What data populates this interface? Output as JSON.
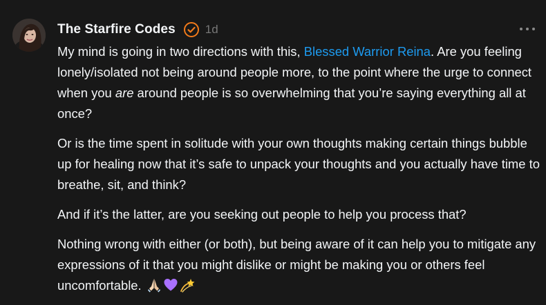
{
  "post": {
    "author": "The Starfire Codes",
    "verified_icon": "verified-check-icon",
    "timestamp": "1d",
    "more_icon": "more-options-icon",
    "colors": {
      "background": "#181818",
      "text": "#f3f5f7",
      "mention": "#1d9bf0",
      "verified": "#f27a1a",
      "timestamp": "#777777"
    },
    "paragraphs": [
      {
        "before": "My mind is going in two directions with this, ",
        "mention": "Blessed Warrior Reina",
        "after_a": ". Are you feeling lonely/isolated not being around people more, to the point where the urge to connect when you ",
        "emphasis": "are",
        "after_b": " around people is so overwhelming that you’re saying everything all at once?"
      },
      {
        "text": "Or is the time spent in solitude with your own thoughts making certain things bubble up for healing now that it’s safe to unpack your thoughts and you actually have time to breathe, sit, and think?"
      },
      {
        "text": "And if it’s the latter, are you seeking out people to help you process that?"
      },
      {
        "text": "Nothing wrong with either (or both), but being aware of it can help you to mitigate any expressions of it that you might dislike or might be making you or others feel uncomfortable.",
        "emojis": [
          "praying-hands-icon",
          "purple-heart-icon",
          "dizzy-star-icon"
        ]
      }
    ]
  }
}
